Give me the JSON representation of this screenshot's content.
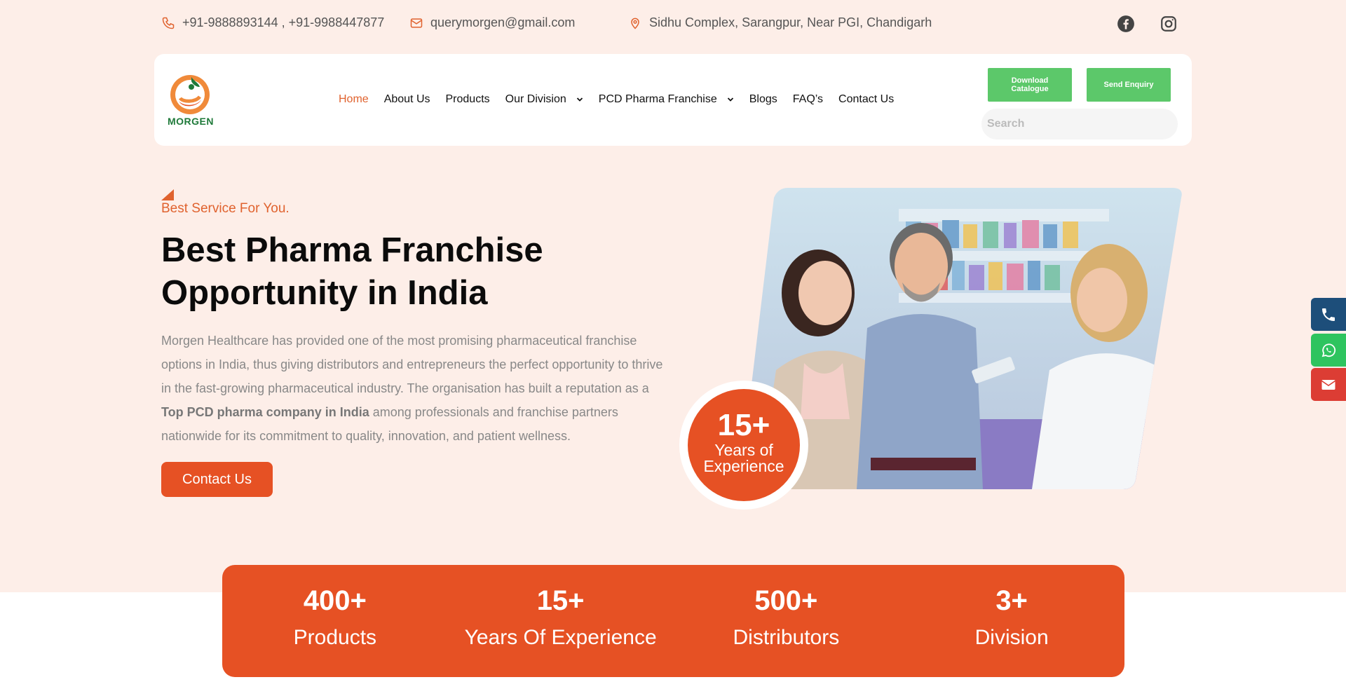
{
  "topbar": {
    "phone": "+91-9888893144 , +91-9988447877",
    "email": "querymorgen@gmail.com",
    "address": "Sidhu Complex, Sarangpur, Near PGI, Chandigarh",
    "social_icons": [
      "facebook-icon",
      "instagram-icon"
    ]
  },
  "header": {
    "logo_text": "MORGEN",
    "nav": [
      {
        "label": "Home",
        "active": true
      },
      {
        "label": "About Us"
      },
      {
        "label": "Products"
      },
      {
        "label": "Our Division",
        "dropdown": true
      },
      {
        "label": "PCD Pharma Franchise",
        "dropdown": true
      },
      {
        "label": "Blogs"
      },
      {
        "label": "FAQ’s"
      },
      {
        "label": "Contact Us"
      }
    ],
    "download_catalogue": "Download Catalogue",
    "send_enquiry": "Send Enquiry",
    "search_placeholder": "Search"
  },
  "hero": {
    "eyebrow": "Best Service For You.",
    "title": "Best Pharma Franchise Opportunity in India",
    "desc_part1": "Morgen Healthcare has provided one of the most promising pharmaceutical franchise options in India, thus giving distributors and entrepreneurs the perfect opportunity to thrive in the fast-growing pharmaceutical industry. The organisation has built a reputation as a ",
    "desc_bold": "Top PCD pharma company in India",
    "desc_part2": " among professionals and franchise partners nationwide for its commitment to quality, innovation, and patient wellness.",
    "cta": "Contact Us",
    "badge_number": "15+",
    "badge_label": "Years of Experience"
  },
  "stats": [
    {
      "value": "400+",
      "label": "Products"
    },
    {
      "value": "15+",
      "label": "Years Of Experience"
    },
    {
      "value": "500+",
      "label": "Distributors"
    },
    {
      "value": "3+",
      "label": "Division"
    }
  ],
  "colors": {
    "accent": "#e65124",
    "green_button": "#5cc86a",
    "hero_bg": "#fdeee8",
    "phone_float": "#1d4e7a",
    "whatsapp_float": "#2ec45f",
    "mail_float": "#dc3d34"
  }
}
